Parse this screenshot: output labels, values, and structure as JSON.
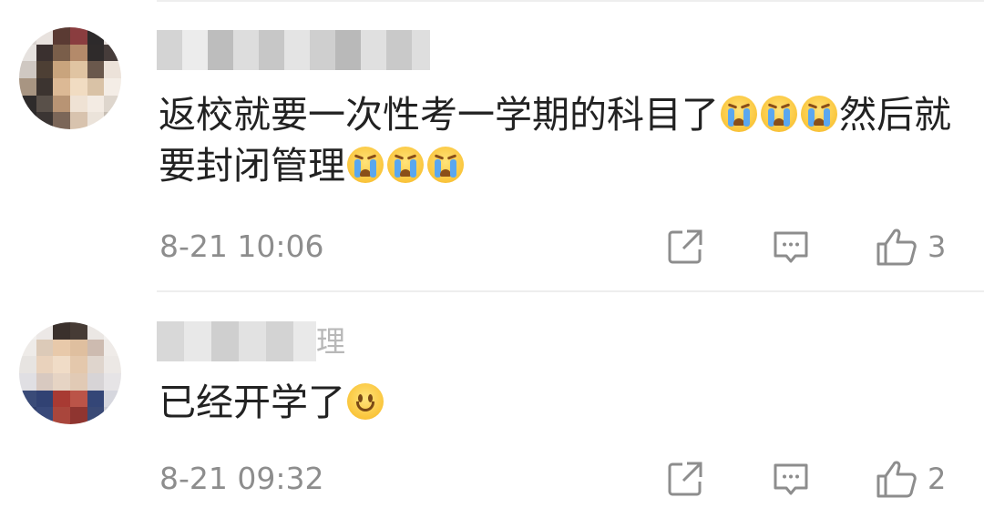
{
  "comments": [
    {
      "text_part1": "返校就要一次性考一学期的科目了",
      "text_part2": "然后就要封闭管理",
      "timestamp": "8-21 10:06",
      "likes": "3",
      "emojis": [
        "crying-emoji",
        "crying-emoji",
        "crying-emoji",
        "crying-emoji",
        "crying-emoji",
        "crying-emoji"
      ]
    },
    {
      "username_tail": "理",
      "text": "已经开学了",
      "timestamp": "8-21 09:32",
      "likes": "2",
      "emojis": [
        "smile-emoji"
      ]
    }
  ],
  "icons": {
    "share": "share-icon",
    "reply": "reply-icon",
    "like": "thumbs-up-icon"
  },
  "colors": {
    "text_primary": "#222222",
    "text_secondary": "#8d8d8d",
    "divider": "#eeeeee",
    "emoji_yellow": "#fac53b",
    "tear_blue": "#5aa7ef"
  }
}
